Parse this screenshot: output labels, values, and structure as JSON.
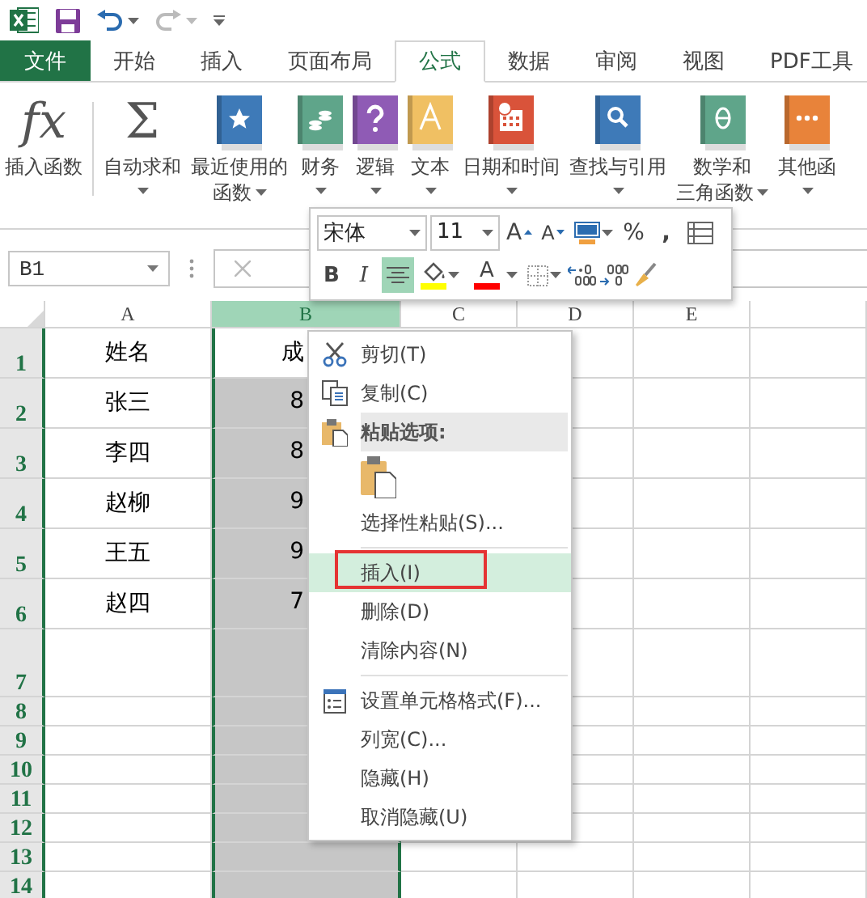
{
  "quick_access": {
    "redo_disabled": true
  },
  "tabs": [
    {
      "label": "文件",
      "kind": "file",
      "selected": false
    },
    {
      "label": "开始",
      "kind": "tab",
      "selected": false
    },
    {
      "label": "插入",
      "kind": "tab",
      "selected": false
    },
    {
      "label": "页面布局",
      "kind": "tab",
      "selected": false
    },
    {
      "label": "公式",
      "kind": "tab",
      "selected": true
    },
    {
      "label": "数据",
      "kind": "tab",
      "selected": false
    },
    {
      "label": "审阅",
      "kind": "tab",
      "selected": false
    },
    {
      "label": "视图",
      "kind": "tab",
      "selected": false
    },
    {
      "label": "PDF工具",
      "kind": "tab",
      "selected": false
    }
  ],
  "ribbon_buttons": [
    {
      "kind": "glyph",
      "glyph": "fx",
      "lines": [
        "插入函数"
      ],
      "dropdown": false
    },
    {
      "kind": "glyph",
      "glyph": "Σ",
      "lines": [
        "自动求和"
      ],
      "dropdown": true
    },
    {
      "kind": "book",
      "color": "#3e7ab8",
      "lines": [
        "最近使用的",
        "函数"
      ],
      "dropdown": true
    },
    {
      "kind": "book",
      "color": "#5fa58a",
      "lines": [
        "财务"
      ],
      "dropdown": true
    },
    {
      "kind": "book",
      "color": "#8f5bb5",
      "lines": [
        "逻辑"
      ],
      "dropdown": true
    },
    {
      "kind": "book",
      "color": "#f0c063",
      "lines": [
        "文本"
      ],
      "dropdown": true
    },
    {
      "kind": "book",
      "color": "#d9533a",
      "lines": [
        "日期和时间"
      ],
      "dropdown": true
    },
    {
      "kind": "book",
      "color": "#3e7ab8",
      "lines": [
        "查找与引用"
      ],
      "dropdown": true
    },
    {
      "kind": "book",
      "color": "#5fa58a",
      "lines": [
        "数学和",
        "三角函数"
      ],
      "dropdown": true
    },
    {
      "kind": "book",
      "color": "#e8833a",
      "lines": [
        "其他函"
      ],
      "dropdown": true
    }
  ],
  "name_box": {
    "value": "B1"
  },
  "columns": [
    {
      "label": "A",
      "selected": false
    },
    {
      "label": "B",
      "selected": true
    },
    {
      "label": "C",
      "selected": false
    },
    {
      "label": "D",
      "selected": false
    },
    {
      "label": "E",
      "selected": false
    }
  ],
  "rows": [
    {
      "header": "1",
      "cells": [
        "姓名",
        "成"
      ]
    },
    {
      "header": "2",
      "cells": [
        "张三",
        "8"
      ]
    },
    {
      "header": "3",
      "cells": [
        "李四",
        "8"
      ]
    },
    {
      "header": "4",
      "cells": [
        "赵柳",
        "9"
      ]
    },
    {
      "header": "5",
      "cells": [
        "王五",
        "9"
      ]
    },
    {
      "header": "6",
      "cells": [
        "赵四",
        "7"
      ]
    },
    {
      "header": "7"
    },
    {
      "header": "8"
    },
    {
      "header": "9"
    },
    {
      "header": "10"
    },
    {
      "header": "11"
    },
    {
      "header": "12"
    },
    {
      "header": "13"
    },
    {
      "header": "14"
    }
  ],
  "mini_toolbar": {
    "font": "宋体",
    "font_size": "11",
    "grow_font": "A",
    "shrink_font": "A",
    "percent": "%",
    "comma": ",",
    "bold": "B",
    "italic": "I",
    "font_color": "A",
    "center_on": true
  },
  "context_menu": [
    {
      "kind": "item",
      "label": "剪切(T)",
      "selected": false
    },
    {
      "kind": "item",
      "label": "复制(C)",
      "selected": false
    },
    {
      "kind": "header",
      "label": "粘贴选项:"
    },
    {
      "kind": "paste_option"
    },
    {
      "kind": "item",
      "label": "选择性粘贴(S)...",
      "selected": false
    },
    {
      "kind": "separator"
    },
    {
      "kind": "item",
      "label": "插入(I)",
      "selected": true,
      "marked": true
    },
    {
      "kind": "item",
      "label": "删除(D)",
      "selected": false
    },
    {
      "kind": "item",
      "label": "清除内容(N)",
      "selected": false
    },
    {
      "kind": "separator"
    },
    {
      "kind": "item",
      "label": "设置单元格格式(F)...",
      "selected": false
    },
    {
      "kind": "item",
      "label": "列宽(C)...",
      "selected": false
    },
    {
      "kind": "item",
      "label": "隐藏(H)",
      "selected": false
    },
    {
      "kind": "item",
      "label": "取消隐藏(U)",
      "selected": false
    }
  ]
}
